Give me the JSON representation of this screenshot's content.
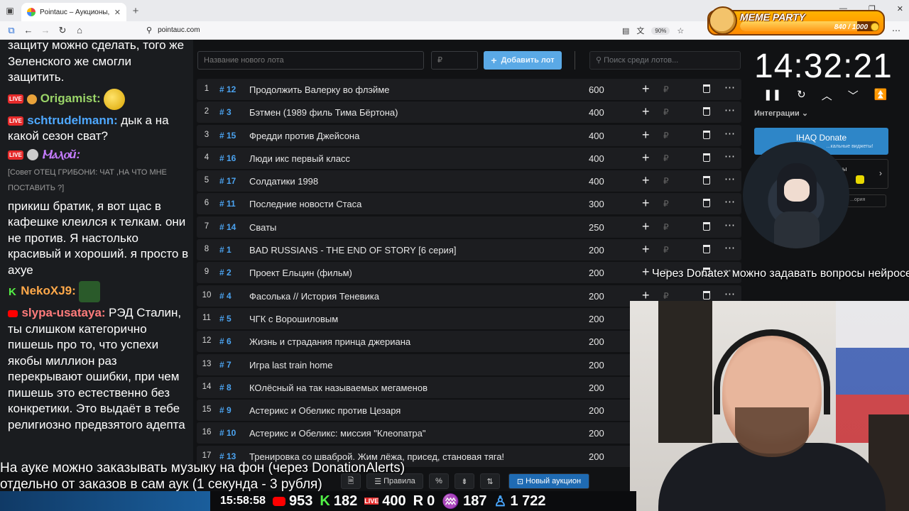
{
  "browser": {
    "tab_title": "Pointauc – Аукционы, лотереи",
    "url": "pointauc.com",
    "zoom": "90%"
  },
  "meme_party": {
    "title": "MEME PARTY",
    "count_text": "840 / 1000",
    "progress": 0.84
  },
  "chat": {
    "messages": [
      {
        "text": "защиту можно сделать, того же Зеленского же смогли защитить."
      },
      {
        "nick": "Origamist:",
        "nick_color": "#9ad468",
        "badge": "LIVE",
        "text": ""
      },
      {
        "nick": "schtrudelmann:",
        "nick_color": "#4ea8ff",
        "badge": "LIVE",
        "text": "дык а на какой сезон сват?"
      },
      {
        "nick": "Ⲙⲁⲗⲟй:",
        "nick_color": "#c67cff",
        "badge": "LIVE",
        "text": ""
      },
      {
        "system": "[Совет ОТЕЦ ГРИБОНИ: ЧАТ ,НА ЧТО МНЕ ПОСТАВИТЬ ?]"
      },
      {
        "text": "прикиш братик, я вот щас в кафешке клеился к телкам. они не против. Я настолько красивый и хороший. я просто в ахуе"
      },
      {
        "nick": "NekoXJ9:",
        "nick_color": "#ffa94a",
        "badge": "K",
        "text": ""
      },
      {
        "nick": "slypa-usataya:",
        "nick_color": "#ff7b7b",
        "badge": "YT",
        "text": "РЭД Сталин, ты слишком категорично пишешь про то, что успехи якобы миллион раз перекрывают ошибки, при чем пишешь это естественно без конкретики. Это выдаёт в тебе религиозно предвзятого адепта"
      }
    ]
  },
  "auction": {
    "new_lot_placeholder": "Название нового лота",
    "amount_placeholder": "₽",
    "add_button": "Добавить лот",
    "search_placeholder": "Поиск среди лотов...",
    "currency_symbol": "₽",
    "lots": [
      {
        "n": "1",
        "id": "# 12",
        "name": "Продолжить Валерку во флэйме",
        "amount": "600"
      },
      {
        "n": "2",
        "id": "# 3",
        "name": "Бэтмен (1989 филь Тима Бёртона)",
        "amount": "400"
      },
      {
        "n": "3",
        "id": "# 15",
        "name": "Фредди против Джейсона",
        "amount": "400"
      },
      {
        "n": "4",
        "id": "# 16",
        "name": "Люди икс первый класс",
        "amount": "400"
      },
      {
        "n": "5",
        "id": "# 17",
        "name": "Солдатики 1998",
        "amount": "400"
      },
      {
        "n": "6",
        "id": "# 11",
        "name": "Последние новости Стаса",
        "amount": "300"
      },
      {
        "n": "7",
        "id": "# 14",
        "name": "Сваты",
        "amount": "250"
      },
      {
        "n": "8",
        "id": "# 1",
        "name": "BAD RUSSIANS - THE END OF STORY [6 серия]",
        "amount": "200"
      },
      {
        "n": "9",
        "id": "# 2",
        "name": "Проект Ельцин (фильм)",
        "amount": "200"
      },
      {
        "n": "10",
        "id": "# 4",
        "name": "Фасолька // История Теневика",
        "amount": "200"
      },
      {
        "n": "11",
        "id": "# 5",
        "name": "ЧГК с Ворошиловым",
        "amount": "200"
      },
      {
        "n": "12",
        "id": "# 6",
        "name": "Жизнь и страдания принца джериана",
        "amount": "200"
      },
      {
        "n": "13",
        "id": "# 7",
        "name": "Игра last train home",
        "amount": "200"
      },
      {
        "n": "14",
        "id": "# 8",
        "name": "КОлёсный на так называемых мегаменов",
        "amount": "200"
      },
      {
        "n": "15",
        "id": "# 9",
        "name": "Астерикс и Обеликс против Цезаря",
        "amount": "200"
      },
      {
        "n": "16",
        "id": "# 10",
        "name": "Астерикс и Обеликс: миссия \"Клеопатра\"",
        "amount": "200"
      },
      {
        "n": "17",
        "id": "# 13",
        "name": "Тренировка со шваброй. Жим лёжа, присед, становая тяга!",
        "amount": "200"
      }
    ]
  },
  "timer": {
    "time": "14:32:21",
    "integrations_label": "Интеграции",
    "donate_card_title": "IHAQ Donate",
    "donate_card_sub": "...кальные виджеты!",
    "card2_text": "...исы",
    "card3_text": "...ория"
  },
  "overlay": {
    "neuro_text": "Через Donatex можно задавать вопросы нейросети",
    "caption_line1": "На ауке можно заказывать музыку на фон (через DonationAlerts)",
    "caption_line2": "отдельно от заказов в сам аук (1 секунда - 3 рубля)"
  },
  "toolbar": {
    "rules": "Правила",
    "new_auction": "Новый аукцион"
  },
  "stats": {
    "time": "15:58:58",
    "youtube": "953",
    "kick": "182",
    "vk": "400",
    "rutube": "0",
    "twitch": "187",
    "total": "1 722"
  }
}
